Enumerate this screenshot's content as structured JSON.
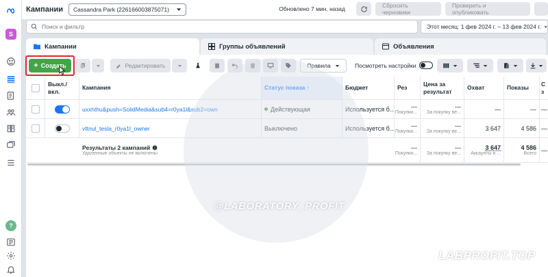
{
  "rail": {
    "avatar_letter": "S"
  },
  "header": {
    "title": "Кампании",
    "account": "Cassandra Park (226166003875071)",
    "updated": "Обновлено 7 мин. назад",
    "discard_label": "Сбросить черновики",
    "review_publish_label": "Проверить и опубликовать"
  },
  "search": {
    "placeholder": "Поиск и фильтр",
    "date_range": "Этот месяц: 1 фев 2024 г. – 13 фев 2024 г."
  },
  "tabs": [
    {
      "label": "Кампании",
      "active": true
    },
    {
      "label": "Группы объявлений",
      "active": false
    },
    {
      "label": "Объявления",
      "active": false
    }
  ],
  "toolbar": {
    "create_label": "Создать",
    "edit_label": "Редактировать",
    "rules_label": "Правила",
    "view_settings_label": "Посмотреть настройки"
  },
  "table": {
    "columns": {
      "onoff": "Выкл./вкл.",
      "campaign": "Кампания",
      "delivery": "Статус показа ↑",
      "budget": "Бюджет",
      "results": "Рез",
      "cost_per_result": "Цена за результат",
      "reach": "Охват",
      "impressions": "Показы",
      "extra": "С з"
    },
    "rows": [
      {
        "enabled": true,
        "campaign": "uxxhthu&push=SolidMedia&sub4=r0ya1l&sub2=own",
        "delivery": "Действующая",
        "delivery_active": true,
        "budget": "Используется б...",
        "results": "—",
        "results_sub": "Покупки...",
        "cost": "—",
        "cost_sub": "За покупку ве...",
        "reach": "—",
        "impressions": "—",
        "extra": "—"
      },
      {
        "enabled": false,
        "campaign": "vttnul_tesla_r0ya1l_owner",
        "delivery": "Выключено",
        "delivery_active": false,
        "budget": "Используется б...",
        "results": "—",
        "results_sub": "Покупки...",
        "cost": "—",
        "cost_sub": "За покупку ве...",
        "reach": "3 647",
        "impressions": "4 586",
        "extra": "—"
      }
    ],
    "summary": {
      "title": "Результаты 2 кампаний",
      "subtitle": "Удаленные объекты не включены",
      "results": "—",
      "results_sub": "Покупки...",
      "cost": "—",
      "cost_sub": "За покупку ве...",
      "reach": "3 647",
      "reach_sub": "Аккаунты в ...",
      "impressions": "4 586",
      "impressions_sub": "Всего",
      "extra": "—"
    }
  },
  "watermark": {
    "channel": "@LABORATORY_PROFIT",
    "site": "LABPROFIT.TOP"
  },
  "colors": {
    "primary": "#1877f2",
    "create_green": "#42a547",
    "highlight_red": "#e0242f",
    "status_green": "#42a547"
  }
}
